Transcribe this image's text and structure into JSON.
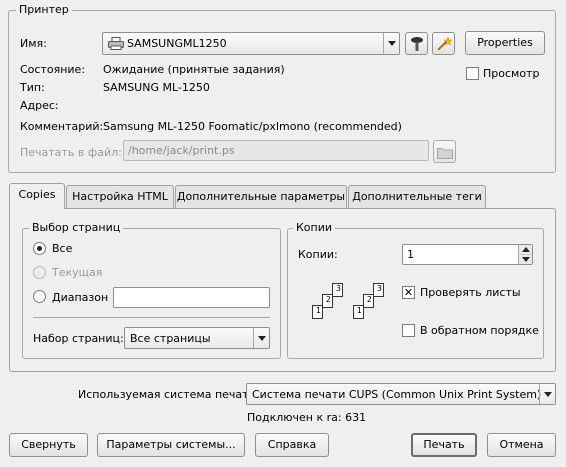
{
  "printer_group": {
    "title": "Принтер",
    "name_label": "Имя:",
    "name_value": "SAMSUNGML1250",
    "properties_button": "Properties",
    "preview_label": "Просмотр",
    "state_label": "Состояние:",
    "state_value": "Ожидание (принятые задания)",
    "type_label": "Тип:",
    "type_value": "SAMSUNG ML-1250",
    "address_label": "Адрес:",
    "address_value": "",
    "comment_label": "Комментарий:",
    "comment_value": "Samsung ML-1250 Foomatic/pxlmono (recommended)",
    "print_to_file_label": "Печатать в файл:",
    "print_to_file_value": "/home/jack/print.ps"
  },
  "tabs": [
    {
      "label": "Copies",
      "active": true
    },
    {
      "label": "Настройка HTML",
      "active": false
    },
    {
      "label": "Дополнительные параметры",
      "active": false
    },
    {
      "label": "Дополнительные теги",
      "active": false
    }
  ],
  "page_selection": {
    "title": "Выбор страниц",
    "all_label": "Все",
    "current_label": "Текущая",
    "range_label": "Диапазон",
    "range_value": "",
    "page_set_label": "Набор страниц:",
    "page_set_value": "Все страницы"
  },
  "copies": {
    "title": "Копии",
    "copies_label": "Копии:",
    "copies_value": "1",
    "collate_label": "Проверять листы",
    "collate_checked": true,
    "reverse_label": "В обратном порядке",
    "reverse_checked": false,
    "page_numbers": [
      "1",
      "2",
      "3"
    ]
  },
  "print_system": {
    "label": "Используемая система печати:",
    "value": "Система печати CUPS (Common Unix Print System)",
    "connected": "Подключен к ra: 631"
  },
  "buttons": {
    "collapse": "Свернуть",
    "system_options": "Параметры системы...",
    "help": "Справка",
    "print": "Печать",
    "cancel": "Отмена"
  }
}
